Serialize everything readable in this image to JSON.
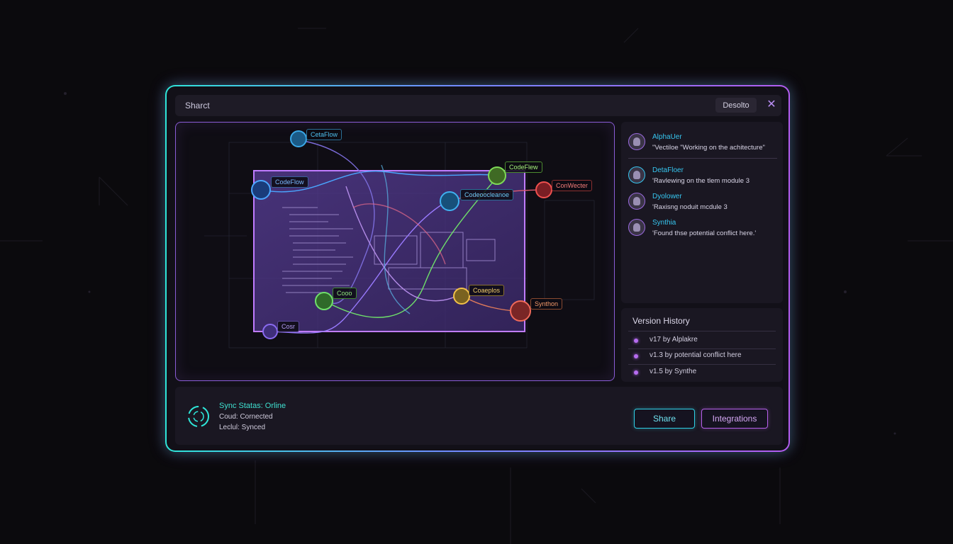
{
  "window": {
    "title": "Sharct",
    "describe_button": "Desolto",
    "close_icon": "close-icon"
  },
  "canvas": {
    "nodes": [
      {
        "label": "CetaFlow",
        "color": "#3aa8e8",
        "icon": "database-icon"
      },
      {
        "label": "CodeFlow",
        "color": "#4aa6ff",
        "icon": "triangle-icon"
      },
      {
        "label": "CodeFlew",
        "color": "#7ed957",
        "icon": "circle-icon"
      },
      {
        "label": "Codeoocleanoe",
        "color": "#3fb0f0",
        "icon": "chip-icon"
      },
      {
        "label": "ConWecter",
        "color": "#f0504f",
        "icon": "server-icon"
      },
      {
        "label": "Cooo",
        "color": "#6fe06a",
        "icon": "cross-icon"
      },
      {
        "label": "Coaeplos",
        "color": "#f2c14a",
        "icon": "gear-icon"
      },
      {
        "label": "Synthon",
        "color": "#f06a5a",
        "icon": "server-icon"
      },
      {
        "label": "Cosr",
        "color": "#8a6bf0",
        "icon": "user-icon"
      }
    ]
  },
  "comments": [
    {
      "name": "AlphaUer",
      "text": "\"Vectiloe \"Working on the achitecture\""
    },
    {
      "name": "DetaFloer",
      "text": "'Ravlewing on the  tlem module 3"
    },
    {
      "name": "Dyolower",
      "text": "'Raxisng noduit mcdule 3"
    },
    {
      "name": "Synthia",
      "text": "'Found thse potential conflict here.'"
    }
  ],
  "version_history": {
    "title": "Version History",
    "items": [
      {
        "label": "v17 by Alplakre"
      },
      {
        "label": "v1.3 by potential conflict here"
      },
      {
        "label": "v1.5 by Synthe"
      }
    ]
  },
  "sync": {
    "status": "Sync Statas: Orline",
    "cloud": "Coud:  Cornected",
    "local": "Leclul:  Synced"
  },
  "buttons": {
    "share": "Share",
    "integrations": "Integrations"
  },
  "colors": {
    "accent_cyan": "#2ee6d9",
    "accent_purple": "#b35cf0",
    "canvas_frame": "#8a5cd6"
  }
}
